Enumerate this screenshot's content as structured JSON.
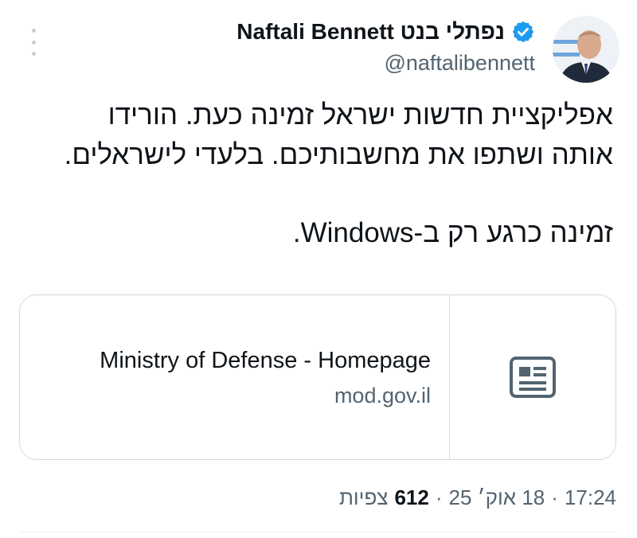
{
  "author": {
    "display_name": "Naftali Bennett נפתלי בנט",
    "handle": "@naftalibennett",
    "verified_color": "#1d9bf0"
  },
  "tweet": {
    "line1": "אפליקציית חדשות ישראל זמינה כעת. הורידו",
    "line2": "אותה ושתפו את מחשבותיכם. בלעדי לישראלים.",
    "line3": "זמינה כרגע רק ב-Windows."
  },
  "card": {
    "title": "Ministry of Defense - Homepage",
    "domain": "mod.gov.il",
    "icon": "newspaper-icon"
  },
  "meta": {
    "time": "17:24",
    "date": "18 אוק׳ 25",
    "views_count": "612",
    "views_label": "צפיות",
    "separator": "·"
  },
  "icons": {
    "more": "more-vertical-icon",
    "verified": "verified-badge-icon"
  }
}
